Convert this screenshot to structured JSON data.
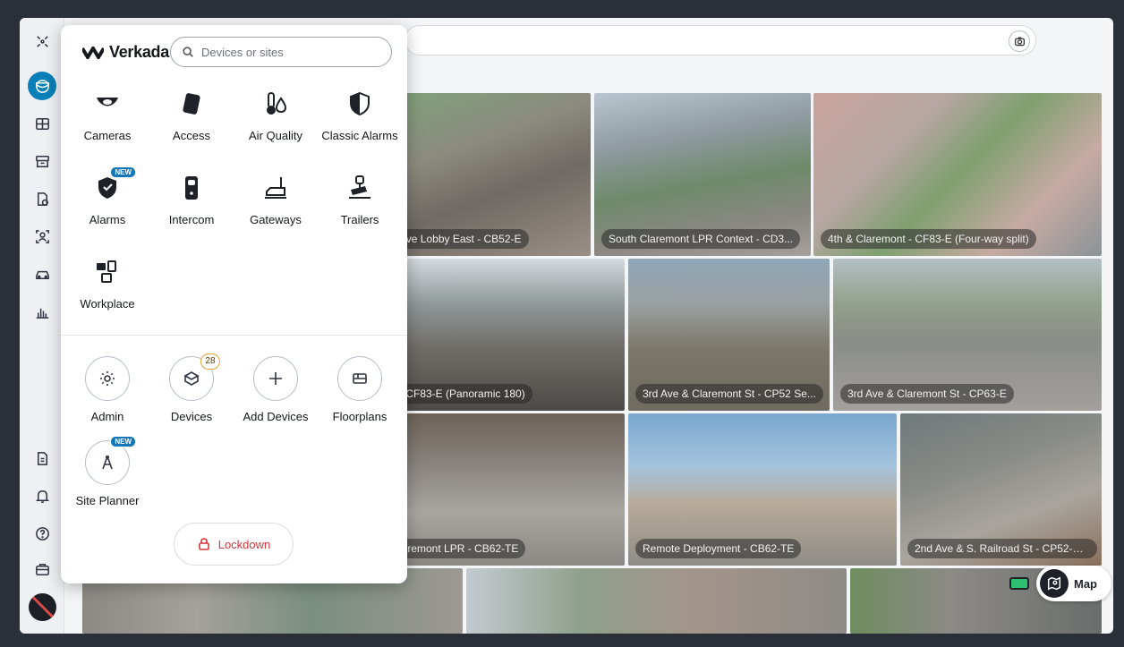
{
  "rail": {
    "items": [
      "command-icon",
      "cameras-icon",
      "access-icon",
      "alarms-icon",
      "devices-icon",
      "people-icon",
      "vehicles-icon",
      "analytics-icon",
      "reports-icon",
      "notifications-icon",
      "help-icon",
      "admin-icon"
    ]
  },
  "panel": {
    "logo": "Verkada",
    "search_placeholder": "Devices or sites",
    "apps": [
      {
        "label": "Cameras"
      },
      {
        "label": "Access"
      },
      {
        "label": "Air Quality"
      },
      {
        "label": "Classic Alarms"
      },
      {
        "label": "Alarms",
        "badge": "NEW"
      },
      {
        "label": "Intercom"
      },
      {
        "label": "Gateways"
      },
      {
        "label": "Trailers"
      },
      {
        "label": "Workplace"
      }
    ],
    "tools": [
      {
        "label": "Admin"
      },
      {
        "label": "Devices",
        "badge": "28"
      },
      {
        "label": "Add Devices"
      },
      {
        "label": "Floorplans"
      },
      {
        "label": "Site Planner",
        "badge": "NEW"
      }
    ],
    "lockdown": "Lockdown"
  },
  "feeds": [
    {
      "label": "Ave Lobby East - CB52-E"
    },
    {
      "label": "South Claremont LPR Context - CD3..."
    },
    {
      "label": "4th & Claremont - CF83-E (Four-way split)"
    },
    {
      "label": "- CF83-E (Panoramic 180)"
    },
    {
      "label": "3rd Ave & Claremont St - CP52 Se..."
    },
    {
      "label": "3rd Ave & Claremont St - CP63-E"
    },
    {
      "label": "laremont LPR - CB62-TE"
    },
    {
      "label": "Remote Deployment - CB62-TE"
    },
    {
      "label": "2nd Ave & S. Railroad St - CP52-E ..."
    }
  ],
  "map": {
    "label": "Map"
  },
  "colors": {
    "accent": "#0a7fb8",
    "danger": "#d9333b",
    "badge": "#1377b8"
  }
}
